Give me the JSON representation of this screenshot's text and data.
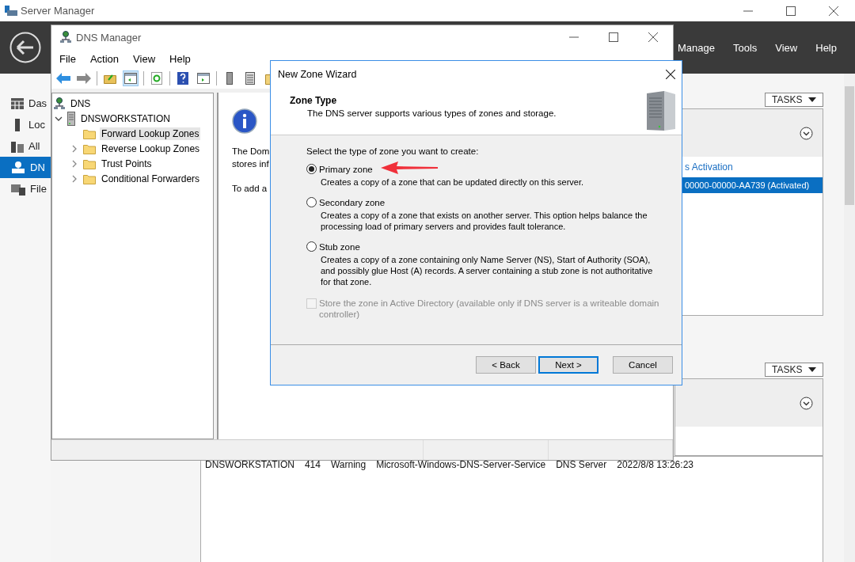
{
  "server_manager": {
    "title": "Server Manager",
    "menu": [
      "Manage",
      "Tools",
      "View",
      "Help"
    ],
    "nav": [
      {
        "label": "Das",
        "kind": "dashboard",
        "selected": false
      },
      {
        "label": "Loc",
        "kind": "local",
        "selected": false
      },
      {
        "label": "All",
        "kind": "all",
        "selected": false
      },
      {
        "label": "DN",
        "kind": "dns",
        "selected": true
      },
      {
        "label": "File",
        "kind": "file",
        "selected": false
      }
    ],
    "tiles": [
      {
        "tasks": "TASKS",
        "link": "s Activation",
        "selected_row": "00000-00000-AA739 (Activated)"
      },
      {
        "tasks": "TASKS"
      }
    ],
    "event_row": [
      "DNSWORKSTATION",
      "414",
      "Warning",
      "Microsoft-Windows-DNS-Server-Service",
      "DNS Server",
      "2022/8/8 13:26:23"
    ]
  },
  "dns_manager": {
    "title": "DNS Manager",
    "menu": [
      "File",
      "Action",
      "View",
      "Help"
    ],
    "tree": [
      {
        "label": "DNS",
        "kind": "dns",
        "selected": false,
        "children": [
          {
            "label": "DNSWORKSTATION",
            "kind": "server",
            "selected": false,
            "expanded": true,
            "children": [
              {
                "label": "Forward Lookup Zones",
                "kind": "folder",
                "selected": true,
                "expandable": false
              },
              {
                "label": "Reverse Lookup Zones",
                "kind": "folder",
                "selected": false,
                "expandable": true
              },
              {
                "label": "Trust Points",
                "kind": "folder",
                "selected": false,
                "expandable": true
              },
              {
                "label": "Conditional Forwarders",
                "kind": "folder",
                "selected": false,
                "expandable": true
              }
            ]
          }
        ]
      }
    ],
    "info_lines": [
      "The Dom",
      "stores inf",
      "To add a"
    ]
  },
  "wizard": {
    "title": "New Zone Wizard",
    "heading": "Zone Type",
    "subheading": "The DNS server supports various types of zones and storage.",
    "prompt": "Select the type of zone you want to create:",
    "options": [
      {
        "label": "Primary zone",
        "description": "Creates a copy of a zone that can be updated directly on this server.",
        "selected": true
      },
      {
        "label": "Secondary zone",
        "description": "Creates a copy of a zone that exists on another server. This option helps balance the processing load of primary servers and provides fault tolerance.",
        "selected": false
      },
      {
        "label": "Stub zone",
        "description": "Creates a copy of a zone containing only Name Server (NS), Start of Authority (SOA), and possibly glue Host (A) records. A server containing a stub zone is not authoritative for that zone.",
        "selected": false
      }
    ],
    "store_in_ad": {
      "label": "Store the zone in Active Directory (available only if DNS server is a writeable domain controller)",
      "checked": false,
      "disabled": true
    },
    "buttons": [
      {
        "label": "< Back",
        "default": false
      },
      {
        "label": "Next >",
        "default": true
      },
      {
        "label": "Cancel",
        "default": false
      }
    ]
  }
}
